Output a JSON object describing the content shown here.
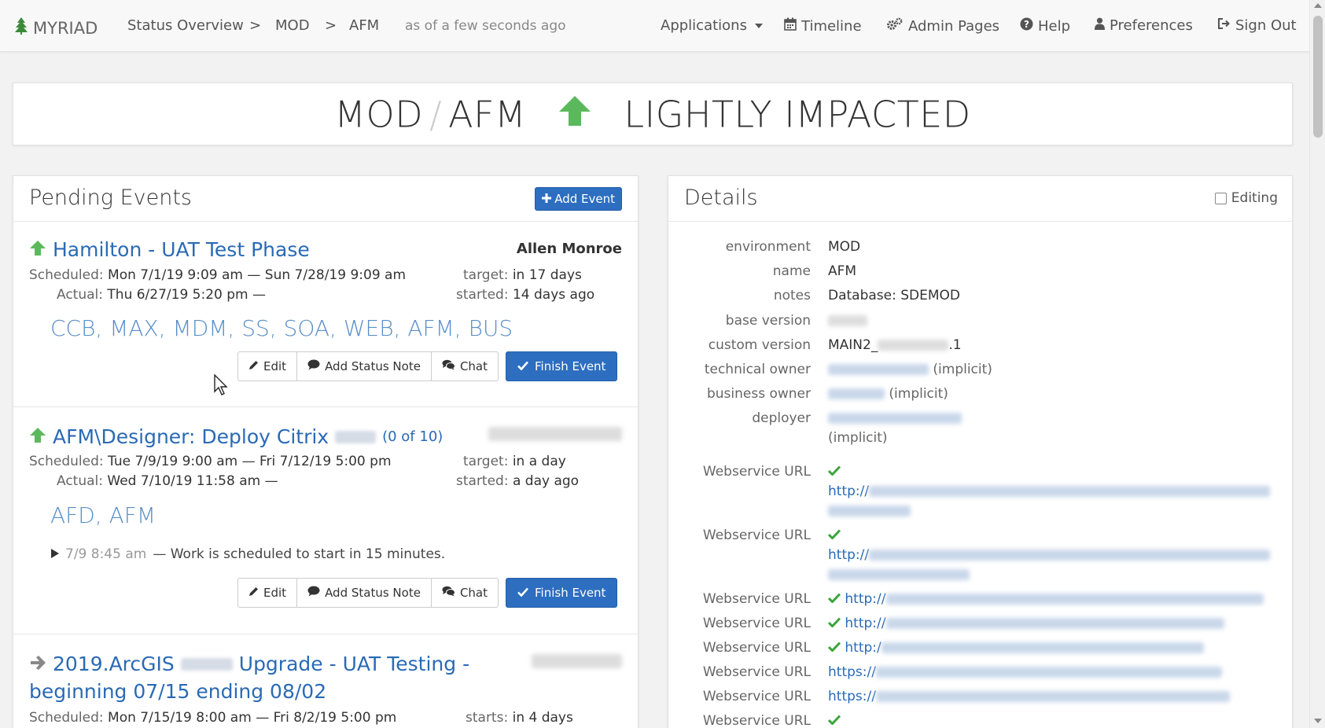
{
  "nav": {
    "brand": "MYRIAD",
    "crumbs": [
      "Status Overview",
      "MOD",
      "AFM"
    ],
    "crumb_sep": ">",
    "as_of": "as of a few seconds ago",
    "applications": "Applications",
    "timeline": "Timeline",
    "admin": "Admin Pages",
    "help": "Help",
    "preferences": "Preferences",
    "signout": "Sign Out"
  },
  "banner": {
    "env": "MOD",
    "sep": "/",
    "name": "AFM",
    "status": "LIGHTLY IMPACTED",
    "status_color": "#5cb85c"
  },
  "pending": {
    "title": "Pending Events",
    "add_button": "Add Event",
    "labels": {
      "scheduled": "Scheduled:",
      "actual": "Actual:",
      "target": "target:",
      "started": "started:",
      "starts": "starts:"
    },
    "buttons": {
      "edit": "Edit",
      "status_note": "Add Status Note",
      "chat": "Chat",
      "finish": "Finish Event"
    },
    "events": [
      {
        "title": "Hamilton - UAT Test Phase",
        "owner": "Allen Monroe",
        "scheduled": "Mon 7/1/19 9:09 am — Sun 7/28/19 9:09 am",
        "actual": "Thu 6/27/19 5:20 pm —",
        "target": "in 17 days",
        "started": "14 days ago",
        "apps": "CCB, MAX, MDM, SS, SOA, WEB, AFM, BUS"
      },
      {
        "title": "AFM\\Designer: Deploy Citrix",
        "count": "(0 of 10)",
        "scheduled": "Tue 7/9/19 9:00 am — Fri 7/12/19 5:00 pm",
        "actual": "Wed 7/10/19 11:58 am —",
        "target": "in a day",
        "started": "a day ago",
        "apps": "AFD, AFM",
        "note_time": "7/9 8:45 am",
        "note_text": "— Work is scheduled to start in 15 minutes."
      },
      {
        "title_a": "2019.ArcGIS",
        "title_b": "Upgrade - UAT Testing -",
        "title_line2": "beginning 07/15 ending 08/02",
        "scheduled": "Mon 7/15/19 8:00 am — Fri 8/2/19 5:00 pm",
        "starts": "in 4 days"
      }
    ]
  },
  "details": {
    "title": "Details",
    "editing": "Editing",
    "rows": {
      "environment": {
        "label": "environment",
        "value": "MOD"
      },
      "name": {
        "label": "name",
        "value": "AFM"
      },
      "notes": {
        "label": "notes",
        "value": "Database: SDEMOD"
      },
      "base_version": {
        "label": "base version"
      },
      "custom_version": {
        "label": "custom version",
        "value_a": "MAIN2_",
        "value_b": ".1"
      },
      "technical_owner": {
        "label": "technical owner",
        "suffix": "(implicit)"
      },
      "business_owner": {
        "label": "business owner",
        "suffix": "(implicit)"
      },
      "deployer": {
        "label": "deployer",
        "suffix": "(implicit)"
      }
    },
    "webservice_label": "Webservice URL",
    "webservices": [
      {
        "prefix": "http://"
      },
      {
        "prefix": "http://"
      },
      {
        "prefix": "http://"
      },
      {
        "prefix": "http://"
      },
      {
        "prefix": "http:/"
      },
      {
        "prefix": "https://"
      },
      {
        "prefix": "https://"
      }
    ]
  }
}
